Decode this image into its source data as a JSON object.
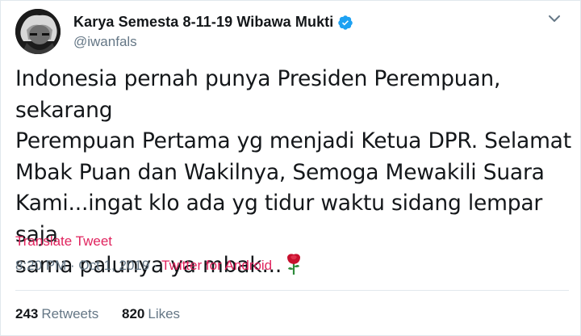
{
  "author": {
    "display_name": "Karya Semesta 8-11-19 Wibawa Mukti",
    "handle": "@iwanfals",
    "verified": true,
    "verified_color": "#1da1f2"
  },
  "tweet": {
    "text": "Indonesia pernah punya Presiden Perempuan, sekarang\nPerempuan Pertama yg menjadi Ketua DPR. Selamat\nMbak Puan dan Wakilnya, Semoga Mewakili Suara\nKami...ingat klo ada yg tidur waktu sidang lempar saja\nsama palunya ya mbak...",
    "emoji": "rose-icon",
    "translate_label": "Translate Tweet",
    "time": "8:20 PM",
    "separator": " · ",
    "date": "Oct 1, 2019",
    "source": "Twitter for Android"
  },
  "stats": {
    "retweets_count": "243",
    "retweets_label": "Retweets",
    "likes_count": "820",
    "likes_label": "Likes"
  },
  "colors": {
    "text": "#14171a",
    "muted": "#657786",
    "accent": "#e0245e",
    "border": "#e1e8ed"
  }
}
